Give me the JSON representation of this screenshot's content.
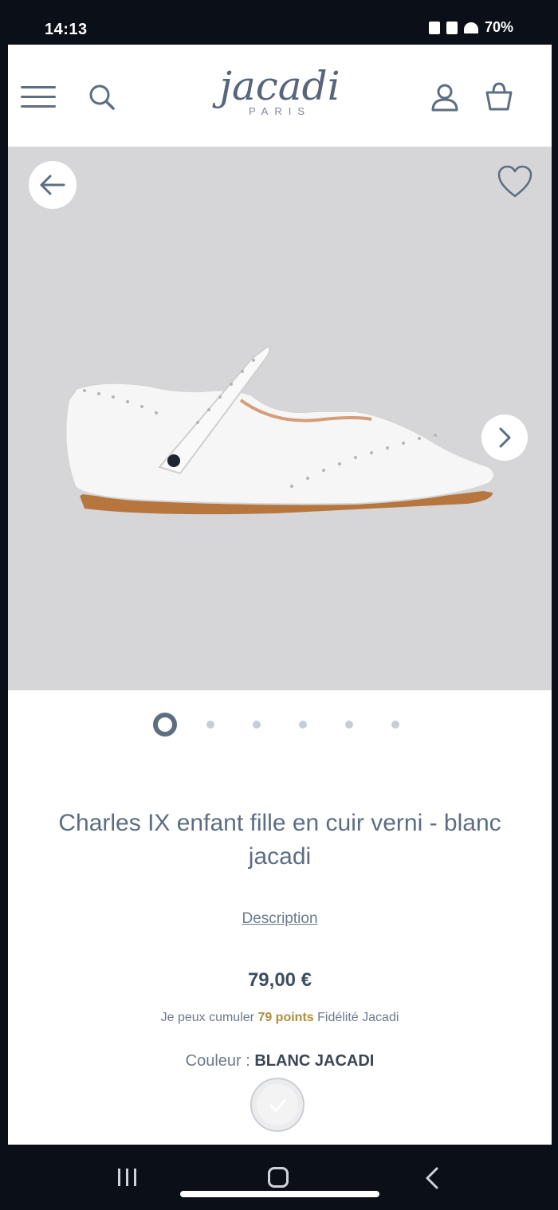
{
  "status_bar": {
    "time": "14:13",
    "battery": "70%"
  },
  "header": {
    "brand": "jacadi",
    "brand_sub": "PARIS",
    "icons": [
      "menu-icon",
      "search-icon",
      "account-icon",
      "bag-icon"
    ]
  },
  "gallery": {
    "image_count": 6,
    "active_index": 0,
    "background": "#d6d6d8",
    "icons": [
      "arrow-left-icon",
      "heart-icon",
      "chevron-right-icon"
    ]
  },
  "product": {
    "title": "Charles IX enfant fille en cuir verni - blanc jacadi",
    "description_link": "Description",
    "price": "79,00 €",
    "loyalty_prefix": "Je peux cumuler",
    "loyalty_points": "79 points",
    "loyalty_suffix": "Fidélité Jacadi",
    "color_label": "Couleur :",
    "color_value": "BLANC JACADI"
  },
  "colors": {
    "brand": "#5d6e82",
    "loyalty_accent": "#b08e3a"
  }
}
